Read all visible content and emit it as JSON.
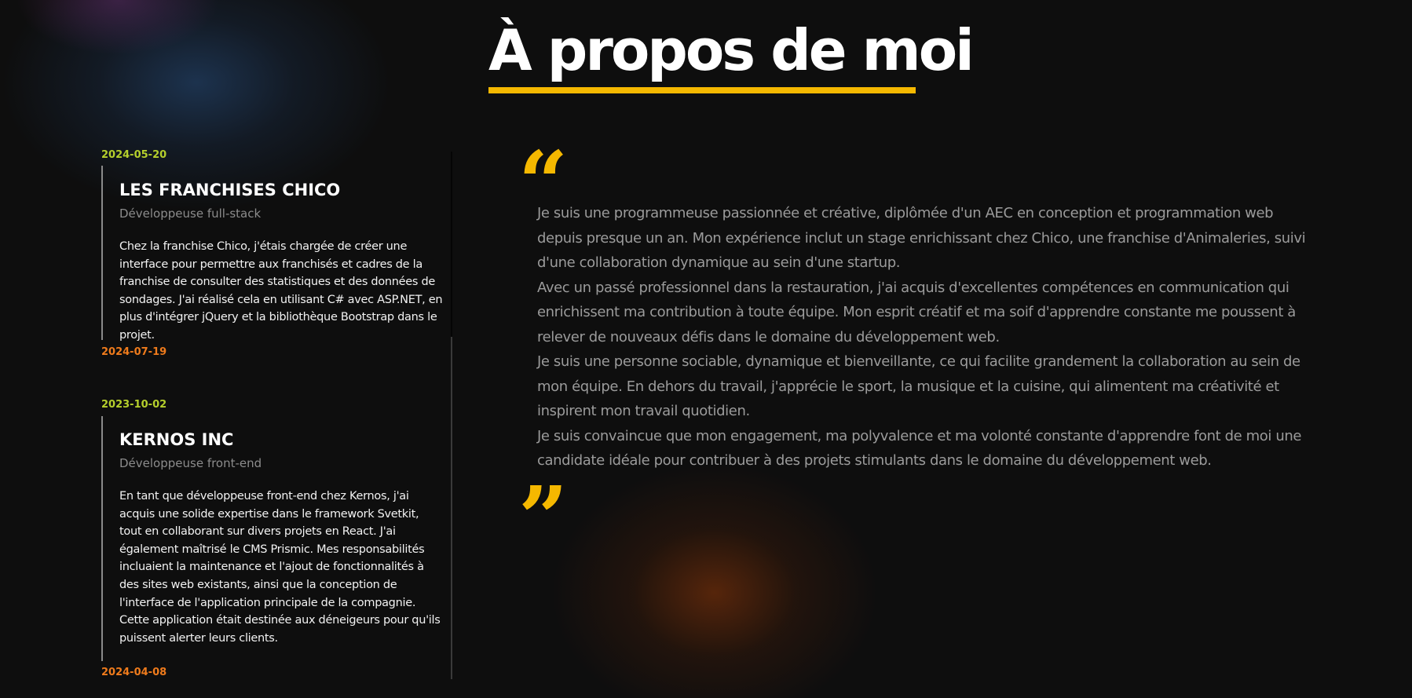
{
  "page": {
    "title": "À propos de moi"
  },
  "experiences": [
    {
      "start_date": "2024-05-20",
      "company": "LES FRANCHISES CHICO",
      "role": "Développeuse full-stack",
      "description": "Chez la franchise Chico, j'étais chargée de créer une interface pour permettre aux franchisés et cadres de la franchise de consulter des statistiques et des données de sondages. J'ai réalisé cela en utilisant C# avec ASP.NET, en plus d'intégrer jQuery et la bibliothèque Bootstrap dans le projet.",
      "end_date": "2024-07-19"
    },
    {
      "start_date": "2023-10-02",
      "company": "KERNOS INC",
      "role": "Développeuse front-end",
      "description": "En tant que développeuse front-end chez Kernos, j'ai acquis une solide expertise dans le framework Svetkit, tout en collaborant sur divers projets en React. J'ai également maîtrisé le CMS Prismic. Mes responsabilités incluaient la maintenance et l'ajout de fonctionnalités à des sites web existants, ainsi que la conception de l'interface de l'application principale de la compagnie. Cette application était destinée aux déneigeurs pour qu'ils puissent alerter leurs clients.",
      "end_date": "2024-04-08"
    }
  ],
  "about": {
    "open_quote": "“",
    "close_quote": "”",
    "paragraphs": [
      "Je suis une programmeuse passionnée et créative, diplômée d'un AEC en conception et programmation web depuis presque un an. Mon expérience inclut un stage enrichissant chez Chico, une franchise d'Animaleries, suivi d'une collaboration dynamique au sein d'une startup.",
      "Avec un passé professionnel dans la restauration, j'ai acquis d'excellentes compétences en communication qui enrichissent ma contribution à toute équipe. Mon esprit créatif et ma soif d'apprendre constante me poussent à relever de nouveaux défis dans le domaine du développement web.",
      "Je suis une personne sociable, dynamique et bienveillante, ce qui facilite grandement la collaboration au sein de mon équipe. En dehors du travail, j'apprécie le sport, la musique et la cuisine, qui alimentent ma créativité et inspirent mon travail quotidien.",
      "Je suis convaincue que mon engagement, ma polyvalence et ma volonté constante d'apprendre font de moi une candidate idéale pour contribuer à des projets stimulants dans le domaine du développement web."
    ]
  },
  "colors": {
    "background": "#0e0e0e",
    "accent_yellow": "#f5b800",
    "start_date_green": "#b5cf2c",
    "end_date_orange": "#ef7b1c",
    "body_text_gray": "#9b9b9b"
  }
}
